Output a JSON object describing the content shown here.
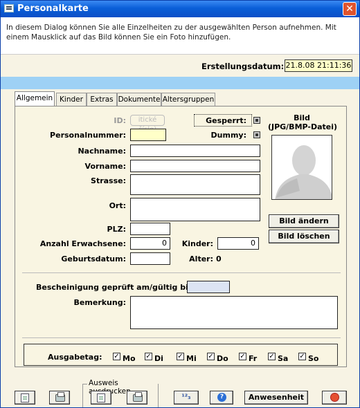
{
  "window": {
    "title": "Personalkarte",
    "close": "✕"
  },
  "intro": "In diesem Dialog können Sie alle Einzelheiten zu der ausgewählten Person aufnehmen. Mit einem Mausklick auf das Bild können Sie ein Foto hinzufügen.",
  "creation": {
    "label": "Erstellungsdatum:",
    "value": "21.8.08 21:11:36"
  },
  "tabs": [
    "Allgemein",
    "Kinder",
    "Extras",
    "Dokumente",
    "Altersgruppen"
  ],
  "form": {
    "id_label": "ID:",
    "id_value": "itické číslo)",
    "personalnummer": "Personalnummer:",
    "nachname": "Nachname:",
    "vorname": "Vorname:",
    "strasse": "Strasse:",
    "ort": "Ort:",
    "plz": "PLZ:",
    "anzahl": "Anzahl Erwachsene:",
    "anzahl_value": "0",
    "kinder": "Kinder:",
    "kinder_value": "0",
    "geburtsdatum": "Geburtsdatum:",
    "alter": "Alter:",
    "alter_value": "0",
    "gesperrt": "Gesperrt:",
    "dummy": "Dummy:",
    "bild_title": "Bild",
    "bild_sub": "(JPG/BMP-Datei)",
    "bild_aendern": "Bild ändern",
    "bild_loeschen": "Bild löschen",
    "bescheinigung": "Bescheinigung geprüft am/gültig bis:",
    "bemerkung": "Bemerkung:"
  },
  "ausgabetag": {
    "label": "Ausgabetag:",
    "days": [
      {
        "label": "Mo",
        "checked": "✓"
      },
      {
        "label": "Di",
        "checked": "✓"
      },
      {
        "label": "Mi",
        "checked": "✓"
      },
      {
        "label": "Do",
        "checked": "✓"
      },
      {
        "label": "Fr",
        "checked": "✓"
      },
      {
        "label": "Sa",
        "checked": "✓"
      },
      {
        "label": "So",
        "checked": "✓"
      }
    ]
  },
  "bottom": {
    "group_label": "Ausweis ausdrucken",
    "anwesenheit": "Anwesenheit",
    "sort_icon": "¹²₃",
    "help_icon": "?"
  },
  "colors": {
    "titlebar": "#0a5fd8",
    "accent_bar": "#9ed1f5",
    "panel": "#f9f5e2",
    "date_bg": "#ffffc8"
  }
}
